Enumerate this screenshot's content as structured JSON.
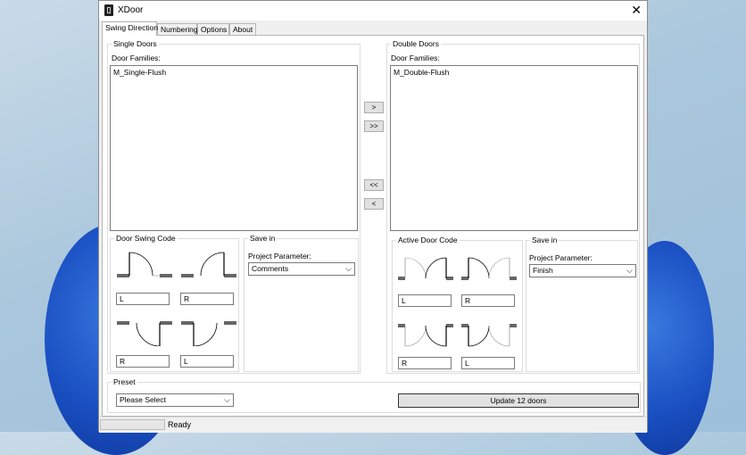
{
  "window": {
    "title": "XDoor",
    "close_glyph": "✕"
  },
  "tabs": [
    {
      "label": "Swing Direction",
      "active": true
    },
    {
      "label": "Numbering"
    },
    {
      "label": "Options"
    },
    {
      "label": "About"
    }
  ],
  "single": {
    "group_title": "Single Doors",
    "families_label": "Door Families:",
    "families": [
      "M_Single-Flush"
    ],
    "swing_group": "Door Swing Code",
    "codes": [
      "L",
      "R",
      "R",
      "L"
    ],
    "save_group": "Save in",
    "param_label": "Project Parameter:",
    "param_value": "Comments"
  },
  "double": {
    "group_title": "Double Doors",
    "families_label": "Door Families:",
    "families": [
      "M_Double-Flush"
    ],
    "active_group": "Active Door Code",
    "codes": [
      "L",
      "R",
      "R",
      "L"
    ],
    "save_group": "Save in",
    "param_label": "Project Parameter:",
    "param_value": "Finish"
  },
  "transfer": {
    "move_right": ">",
    "move_all_right": ">>",
    "move_all_left": "<<",
    "move_left": "<"
  },
  "preset": {
    "group_title": "Preset",
    "value": "Please Select"
  },
  "update_label": "Update 12 doors",
  "status": {
    "text": "Ready"
  }
}
